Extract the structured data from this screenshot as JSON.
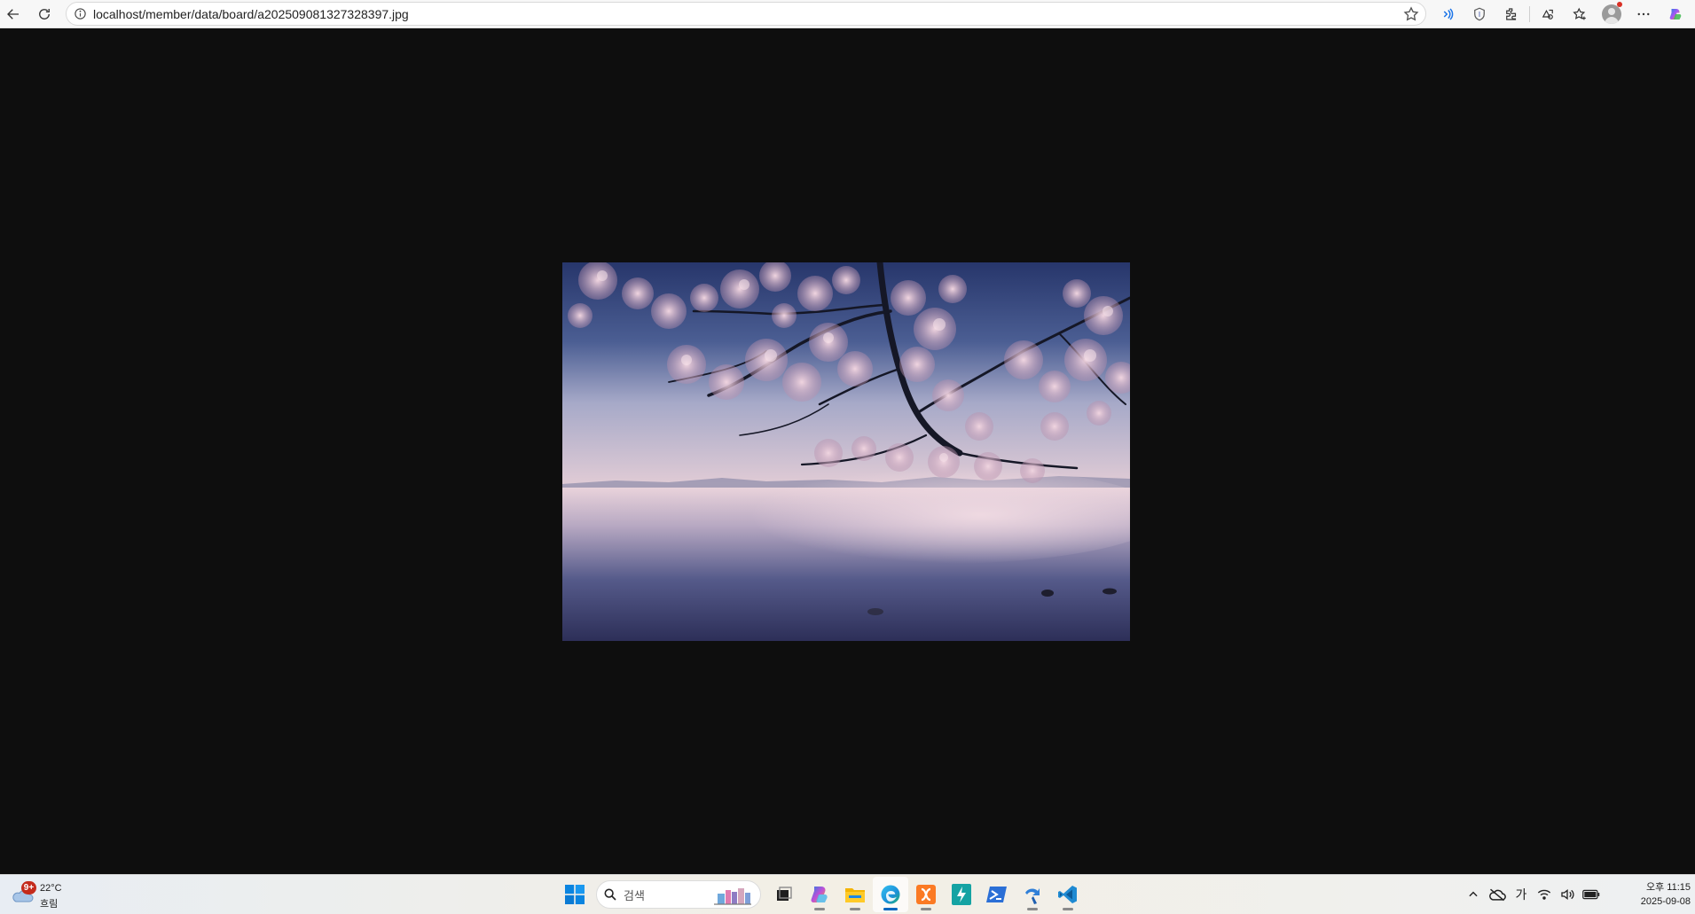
{
  "browser": {
    "url": "localhost/member/data/board/a202509081327328397.jpg",
    "icons": [
      "back-icon",
      "refresh-icon",
      "info-icon",
      "favorite-star-icon",
      "read-aloud-icon",
      "shield-icon",
      "extensions-icon",
      "collections-icon",
      "favorites-icon",
      "profile-icon",
      "more-icon",
      "copilot-icon"
    ]
  },
  "image": {
    "description_icon": "photo",
    "colors": {
      "sky_top": "#2b3a6e",
      "sky_mid": "#6b7aa6",
      "horizon": "#d8c3cf",
      "water": "#3b3f6e",
      "blossom": "#d9b6c6"
    }
  },
  "taskbar": {
    "weather": {
      "badge": "9+",
      "temperature": "22°C",
      "condition": "흐림"
    },
    "search": {
      "placeholder": "검색"
    },
    "apps": [
      "start-icon",
      "task-view-icon",
      "copilot-icon",
      "file-explorer-icon",
      "edge-icon",
      "xampp-icon",
      "app-bolt-icon",
      "powershell-icon",
      "app-arrow-icon",
      "vscode-icon"
    ],
    "tray": {
      "ime": "가"
    },
    "clock": {
      "time": "오후 11:15",
      "date": "2025-09-08"
    }
  }
}
